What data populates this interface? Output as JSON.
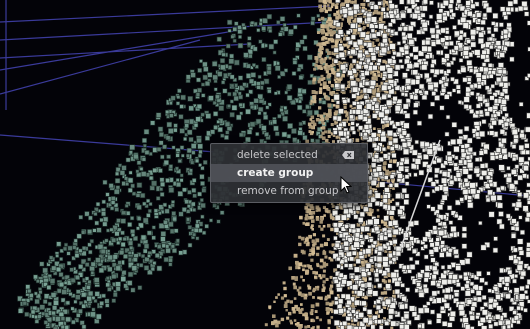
{
  "context_menu": {
    "items": [
      {
        "label": "delete selected",
        "shortcut_icon": "backspace-icon",
        "highlighted": false
      },
      {
        "label": "create group",
        "highlighted": true
      },
      {
        "label": "remove from group",
        "highlighted": false
      }
    ]
  },
  "colors": {
    "background": "#030308",
    "point_cloud_teal": "#6f9488",
    "point_cloud_tan": "#c2ad88",
    "point_cloud_white": "#eeeeea",
    "grid_lines": "#3a3a9a",
    "menu_background": "#2e3034",
    "menu_text": "#c9c9cc"
  }
}
